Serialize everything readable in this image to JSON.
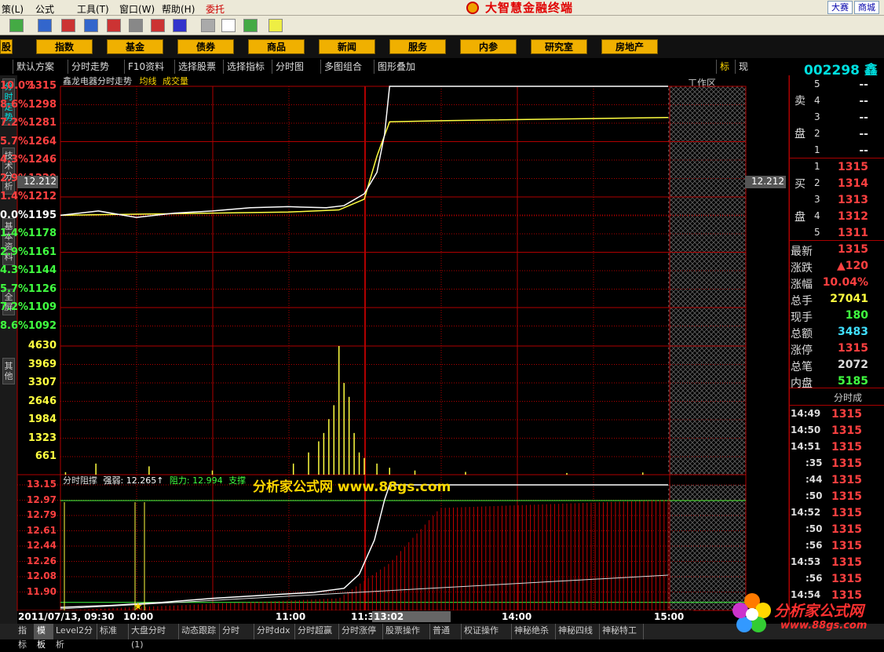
{
  "menu": [
    "策(L)",
    "公式",
    "工具(T)",
    "窗口(W)",
    "帮助(H)",
    "委托"
  ],
  "app_title": "大智慧金融终端",
  "top_right": [
    "大赛",
    "商城"
  ],
  "categories": [
    "指数",
    "基金",
    "债券",
    "商品",
    "新闻",
    "服务",
    "内参",
    "研究室",
    "房地产"
  ],
  "workzone": "工作区",
  "subbar": [
    "默认方案",
    "分时走势",
    "F10资料",
    "选择股票",
    "选择指标",
    "分时图",
    "多图组合",
    "图形叠加"
  ],
  "sub_right": [
    "标",
    "现"
  ],
  "side_tabs": [
    "分时走势",
    "技术分析",
    "基本资料",
    "全屏",
    "其他"
  ],
  "stock_code": "002298 鑫龙",
  "chart_title": "鑫龙电器分时走势",
  "chart_legend": [
    "均线",
    "成交量"
  ],
  "price_axis": [
    "1315",
    "1298",
    "1281",
    "1264",
    "1246",
    "1229",
    "1212",
    "1195",
    "1178",
    "1161",
    "1144",
    "1126",
    "1109",
    "1092"
  ],
  "pct_axis": [
    "10.0%",
    "8.6%",
    "7.2%",
    "5.7%",
    "4.3%",
    "2.9%",
    "1.4%",
    "0.0%",
    "1.4%",
    "2.9%",
    "4.3%",
    "5.7%",
    "7.2%",
    "8.6%"
  ],
  "cross_value": "12.212",
  "vol_axis": [
    "4630",
    "3969",
    "3307",
    "2646",
    "1984",
    "1323",
    "661"
  ],
  "ind_title": "分时阻撑",
  "ind_strength": "强弱: 12.265↑",
  "ind_resist": "阻力: 12.994",
  "ind_support": "支撑",
  "ind_axis": [
    "13.15",
    "12.97",
    "12.79",
    "12.61",
    "12.44",
    "12.26",
    "12.08",
    "11.90"
  ],
  "watermark": "分析家公式网 www.88gs.com",
  "time_labels": [
    "2011/07/13, 09:30",
    "10:00",
    "11:00",
    "11:30",
    "13:02",
    "14:00",
    "15:00"
  ],
  "sell": {
    "label_a": "卖",
    "label_b": "盘",
    "rows": [
      {
        "n": "5",
        "p": "--"
      },
      {
        "n": "4",
        "p": "--"
      },
      {
        "n": "3",
        "p": "--"
      },
      {
        "n": "2",
        "p": "--"
      },
      {
        "n": "1",
        "p": "--"
      }
    ]
  },
  "buy": {
    "label_a": "买",
    "label_b": "盘",
    "rows": [
      {
        "n": "1",
        "p": "1315"
      },
      {
        "n": "2",
        "p": "1314"
      },
      {
        "n": "3",
        "p": "1313"
      },
      {
        "n": "4",
        "p": "1312"
      },
      {
        "n": "5",
        "p": "1311"
      }
    ]
  },
  "quote": [
    {
      "k": "最新",
      "v": "1315",
      "c": "#ff4040"
    },
    {
      "k": "涨跌",
      "v": "▲120",
      "c": "#ff4040"
    },
    {
      "k": "涨幅",
      "v": "10.04%",
      "c": "#ff4040"
    },
    {
      "k": "总手",
      "v": "27041",
      "c": "#ffff40"
    },
    {
      "k": "现手",
      "v": "180",
      "c": "#40ff40"
    },
    {
      "k": "总额",
      "v": "3483",
      "c": "#40e0ff"
    },
    {
      "k": "涨停",
      "v": "1315",
      "c": "#ff4040"
    },
    {
      "k": "总笔",
      "v": "2072",
      "c": "#dddddd"
    },
    {
      "k": "内盘",
      "v": "5185",
      "c": "#40ff40"
    }
  ],
  "ticks_title": "分时成",
  "ticks": [
    {
      "t": "14:49",
      "p": "1315"
    },
    {
      "t": "14:50",
      "p": "1315"
    },
    {
      "t": "14:51",
      "p": "1315"
    },
    {
      "t": ":35",
      "p": "1315"
    },
    {
      "t": ":44",
      "p": "1315"
    },
    {
      "t": ":50",
      "p": "1315"
    },
    {
      "t": "14:52",
      "p": "1315"
    },
    {
      "t": ":50",
      "p": "1315"
    },
    {
      "t": ":56",
      "p": "1315"
    },
    {
      "t": "14:53",
      "p": "1315"
    },
    {
      "t": ":56",
      "p": "1315"
    },
    {
      "t": "14:54",
      "p": "1315"
    }
  ],
  "bottom_tabs": [
    "指标",
    "模板",
    "Level2分析",
    "标准",
    "大盘分时(1)",
    "动态跟踪",
    "分时",
    "分时ddx",
    "分时超赢",
    "分时涨停",
    "股票操作",
    "普通",
    "权证操作",
    "神秘绝杀",
    "神秘四线",
    "神秘特工"
  ],
  "wm_logo_text": "分析家公式网",
  "wm_logo_url": "www.88gs.com",
  "chart_data": {
    "type": "line",
    "title": "鑫龙电器分时走势",
    "prev_close": 1195,
    "ylim": [
      1092,
      1315
    ],
    "price": [
      [
        0,
        1195
      ],
      [
        15,
        1199
      ],
      [
        30,
        1193
      ],
      [
        45,
        1197
      ],
      [
        60,
        1199
      ],
      [
        75,
        1202
      ],
      [
        90,
        1203
      ],
      [
        105,
        1202
      ],
      [
        112,
        1204
      ],
      [
        120,
        1215
      ],
      [
        125,
        1235
      ],
      [
        128,
        1270
      ],
      [
        130,
        1315
      ],
      [
        150,
        1315
      ],
      [
        240,
        1315
      ]
    ],
    "avg": [
      [
        0,
        1195
      ],
      [
        30,
        1196
      ],
      [
        60,
        1197
      ],
      [
        90,
        1198
      ],
      [
        110,
        1200
      ],
      [
        120,
        1210
      ],
      [
        125,
        1250
      ],
      [
        130,
        1282
      ],
      [
        150,
        1283
      ],
      [
        240,
        1286
      ]
    ],
    "volume": [
      [
        2,
        90
      ],
      [
        14,
        400
      ],
      [
        35,
        300
      ],
      [
        60,
        150
      ],
      [
        92,
        400
      ],
      [
        98,
        800
      ],
      [
        102,
        1200
      ],
      [
        104,
        1500
      ],
      [
        106,
        2000
      ],
      [
        108,
        2500
      ],
      [
        110,
        4630
      ],
      [
        112,
        3300
      ],
      [
        114,
        2800
      ],
      [
        116,
        1500
      ],
      [
        118,
        800
      ],
      [
        120,
        600
      ],
      [
        125,
        400
      ],
      [
        130,
        250
      ],
      [
        140,
        150
      ],
      [
        160,
        100
      ],
      [
        200,
        60
      ],
      [
        230,
        80
      ]
    ]
  }
}
